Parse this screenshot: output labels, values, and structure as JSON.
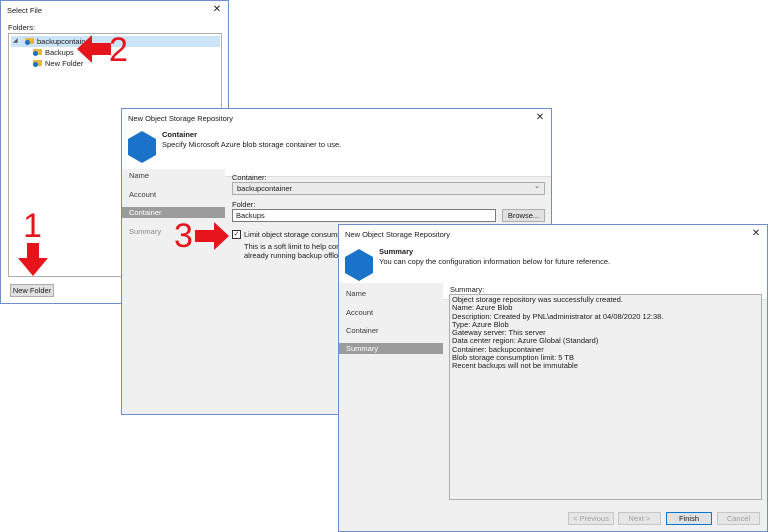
{
  "select_file": {
    "title": "Select File",
    "folders_label": "Folders:",
    "tree": [
      {
        "label": "backupcontainer",
        "expanded": true,
        "selected": true
      },
      {
        "label": "Backups"
      },
      {
        "label": "New Folder"
      }
    ],
    "new_folder_button": "New Folder"
  },
  "container_wizard": {
    "title": "New Object Storage Repository",
    "header_title": "Container",
    "header_desc": "Specify Microsoft Azure blob storage container to use.",
    "nav": [
      "Name",
      "Account",
      "Container",
      "Summary"
    ],
    "active_step": "Container",
    "container_label": "Container:",
    "container_value": "backupcontainer",
    "folder_label": "Folder:",
    "folder_value": "Backups",
    "browse_button": "Browse...",
    "limit_checkbox_label": "Limit object storage consumptio",
    "limit_checked": true,
    "limit_desc_1": "This is a soft limit to help contro",
    "limit_desc_2": "already running backup offload"
  },
  "summary_wizard": {
    "title": "New Object Storage Repository",
    "header_title": "Summary",
    "header_desc": "You can copy the configuration information below for future reference.",
    "nav": [
      "Name",
      "Account",
      "Container",
      "Summary"
    ],
    "active_step": "Summary",
    "summary_label": "Summary:",
    "summary_lines": [
      "Object storage repository was successfully created.",
      "Name: Azure Blob",
      "Description: Created by PNL\\administrator at 04/08/2020 12:38.",
      "Type: Azure Blob",
      "Gateway server: This server",
      "Data center region: Azure Global (Standard)",
      "Container: backupcontainer",
      "Blob storage consumption limit: 5 TB",
      "Recent backups will not be immutable"
    ],
    "buttons": {
      "previous": "< Previous",
      "next": "Next >",
      "finish": "Finish",
      "cancel": "Cancel"
    }
  },
  "annotations": [
    "1",
    "2",
    "3"
  ],
  "colors": {
    "accent_blue": "#1a72c9",
    "arrow_red": "#e8141b",
    "selection": "#cce4f7",
    "nav_active": "#9c9c9c"
  }
}
